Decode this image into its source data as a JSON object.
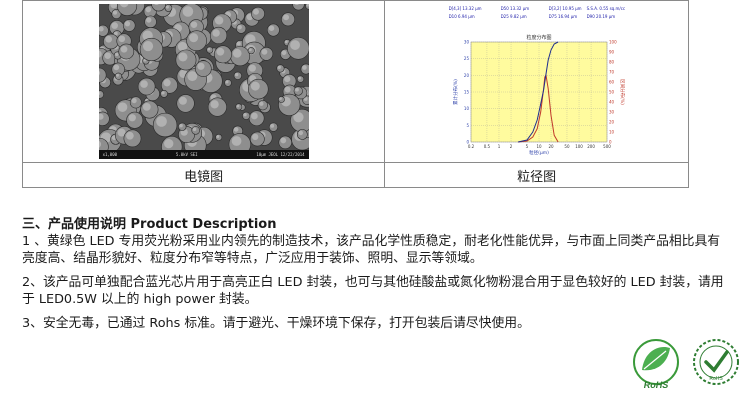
{
  "figures": {
    "sem_caption": "电镜图",
    "psd_caption": "粒径图",
    "sem_info_left": "x1,000",
    "sem_info_mid": "5.0kV  SEI",
    "sem_info_right": "10μm  JEOL  12/22/2014",
    "psd": {
      "params": [
        {
          "label": "D[4,3]",
          "value": "13.32 μm"
        },
        {
          "label": "D50",
          "value": "13.32 μm"
        },
        {
          "label": "D[3,2]",
          "value": "10.95 μm"
        },
        {
          "label": "S.S.A.",
          "value": "0.55 sq.m/cc"
        },
        {
          "label": "D10",
          "value": "6.94 μm"
        },
        {
          "label": "D25",
          "value": "9.82 μm"
        },
        {
          "label": "D75",
          "value": "16.94 μm"
        },
        {
          "label": "D90",
          "value": "20.19 μm"
        }
      ],
      "colors": {
        "background": "#fffb9e",
        "density": "#c0392b",
        "cumulative": "#1f2f8f",
        "axis_left": "#2a3ea8",
        "axis_right": "#c0392b"
      }
    }
  },
  "chart_data": {
    "type": "line",
    "title": "粒度分布图",
    "xlabel": "粒径(μm)",
    "ylabel": "累计分布(%)",
    "y2label": "区间分布(%)",
    "xscale": "log",
    "xlim": [
      0.2,
      500
    ],
    "ylim": [
      0,
      30
    ],
    "y2lim": [
      0,
      100
    ],
    "xticks": [
      "0.2",
      "0.5",
      "1",
      "2",
      "5",
      "10",
      "20",
      "50",
      "100",
      "200",
      "500"
    ],
    "yticks": [
      "0",
      "5",
      "10",
      "15",
      "20",
      "25",
      "30"
    ],
    "y2ticks": [
      "0",
      "10",
      "20",
      "30",
      "40",
      "50",
      "60",
      "70",
      "80",
      "90",
      "100"
    ],
    "series": [
      {
        "role": "density",
        "x": [
          3,
          5,
          7,
          9,
          11,
          13,
          14,
          15,
          17,
          20,
          24,
          30
        ],
        "y": [
          0,
          0.3,
          1.5,
          4,
          9,
          16,
          19.5,
          20,
          16,
          8,
          2,
          0
        ]
      },
      {
        "role": "cumulative",
        "x": [
          3,
          5,
          7,
          9,
          11,
          13,
          15,
          17,
          20,
          24,
          30
        ],
        "y": [
          0,
          2,
          10,
          22,
          38,
          52,
          68,
          82,
          92,
          98,
          100
        ]
      }
    ]
  },
  "section": {
    "title": "三、产品使用说明  Product  Description",
    "para1": "1 、黄绿色 LED 专用荧光粉采用业内领先的制造技术，该产品化学性质稳定，耐老化性能优异，与市面上同类产品相比具有亮度高、结晶形貌好、粒度分布窄等特点，广泛应用于装饰、照明、显示等领域。",
    "para2": "2、该产品可单独配合蓝光芯片用于高亮正白 LED 封装，也可与其他硅酸盐或氮化物粉混合用于显色较好的 LED 封装，请用于 LED0.5W 以上的 high  power 封装。",
    "para3": "3、安全无毒，已通过 Rohs 标准。请于避光、干燥环境下保存，打开包装后请尽快使用。"
  },
  "logos": {
    "rohs_leaf": "RoHS",
    "rohs_check": "RoHS"
  }
}
